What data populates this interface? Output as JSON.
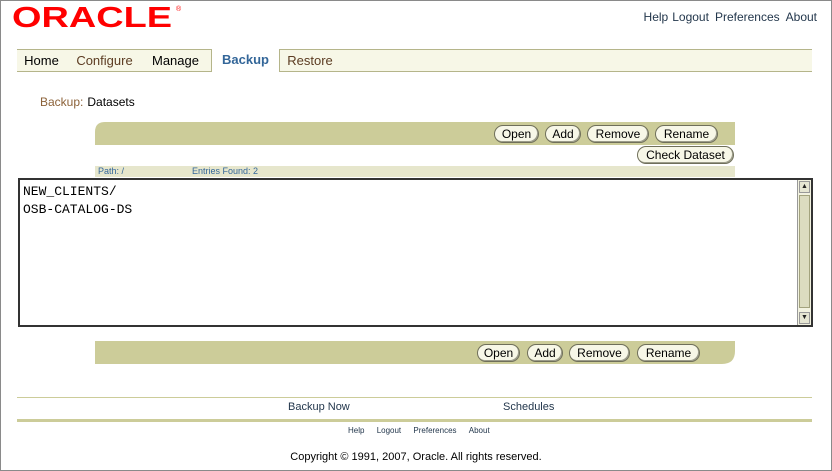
{
  "header": {
    "brand": "ORACLE",
    "brand_color": "#ff0000",
    "global_links": [
      "Help",
      "Logout",
      "Preferences",
      "About"
    ]
  },
  "tabs": [
    {
      "label": "Home",
      "state": "normal"
    },
    {
      "label": "Configure",
      "state": "dim"
    },
    {
      "label": "Manage",
      "state": "normal"
    },
    {
      "label": "Backup",
      "state": "selected"
    },
    {
      "label": "Restore",
      "state": "dim"
    }
  ],
  "breadcrumb": {
    "link": "Backup:",
    "current": "Datasets"
  },
  "toolbar_top": {
    "open": "Open",
    "add": "Add",
    "remove": "Remove",
    "rename": "Rename",
    "check": "Check Dataset"
  },
  "pathbar": {
    "path": "Path: /",
    "entries": "Entries Found: 2"
  },
  "list": {
    "items": [
      "NEW_CLIENTS/",
      "OSB-CATALOG-DS"
    ]
  },
  "toolbar_bottom": {
    "open": "Open",
    "add": "Add",
    "remove": "Remove",
    "rename": "Rename"
  },
  "bottom_links": {
    "backup_now": "Backup Now",
    "schedules": "Schedules"
  },
  "footer": {
    "links": [
      "Help",
      "Logout",
      "Preferences",
      "About"
    ],
    "copyright": "Copyright © 1991, 2007, Oracle. All rights reserved."
  },
  "colors": {
    "accent": "#336699",
    "band": "#cccc99",
    "tabbar": "#f7f7e7"
  }
}
